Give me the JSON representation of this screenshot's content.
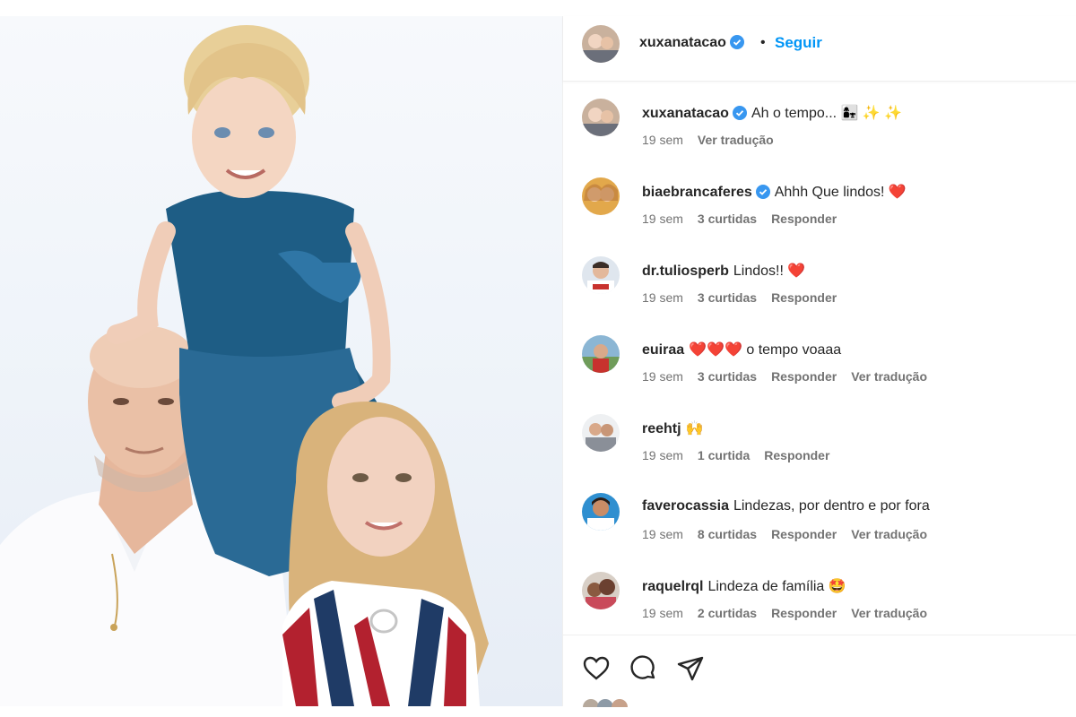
{
  "post": {
    "author": "xuxanatacao",
    "follow_label": "Seguir",
    "separator": "•"
  },
  "comments": [
    {
      "user": "xuxanatacao",
      "verified": true,
      "text": "Ah o tempo... 👩‍👧 ✨ ✨",
      "time": "19 sem",
      "likes": "",
      "actions": [
        "Ver tradução"
      ]
    },
    {
      "user": "biaebrancaferes",
      "verified": true,
      "text": "Ahhh Que lindos! ❤️",
      "time": "19 sem",
      "likes": "3 curtidas",
      "actions": [
        "Responder"
      ]
    },
    {
      "user": "dr.tuliosperb",
      "verified": false,
      "text": "Lindos!! ❤️",
      "time": "19 sem",
      "likes": "3 curtidas",
      "actions": [
        "Responder"
      ]
    },
    {
      "user": "euiraa",
      "verified": false,
      "text": "❤️❤️❤️ o tempo voaaa",
      "time": "19 sem",
      "likes": "3 curtidas",
      "actions": [
        "Responder",
        "Ver tradução"
      ]
    },
    {
      "user": "reehtj",
      "verified": false,
      "text": "🙌",
      "time": "19 sem",
      "likes": "1 curtida",
      "actions": [
        "Responder"
      ]
    },
    {
      "user": "faverocassia",
      "verified": false,
      "text": "Lindezas, por dentro e por fora",
      "time": "19 sem",
      "likes": "8 curtidas",
      "actions": [
        "Responder",
        "Ver tradução"
      ]
    },
    {
      "user": "raquelrql",
      "verified": false,
      "text": "Lindeza de família 🤩",
      "time": "19 sem",
      "likes": "2 curtidas",
      "actions": [
        "Responder",
        "Ver tradução"
      ]
    }
  ],
  "icons": {
    "like": "heart-outline-icon",
    "comment": "comment-bubble-icon",
    "share": "paper-plane-icon",
    "verified": "verified-badge-icon"
  },
  "colors": {
    "follow": "#0095f6",
    "verified": "#3897f0",
    "meta": "#737373",
    "text": "#262626"
  }
}
